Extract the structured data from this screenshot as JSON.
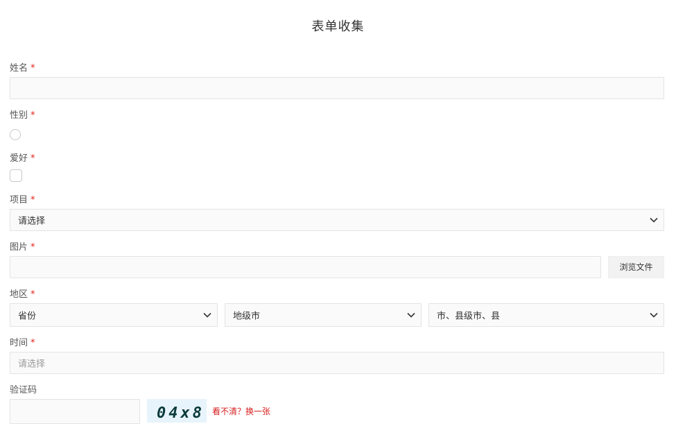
{
  "form": {
    "title": "表单收集",
    "required_mark": "*",
    "fields": {
      "name": {
        "label": "姓名"
      },
      "gender": {
        "label": "性别"
      },
      "hobby": {
        "label": "爱好"
      },
      "project": {
        "label": "项目",
        "selected": "请选择"
      },
      "image": {
        "label": "图片",
        "browse_label": "浏览文件"
      },
      "region": {
        "label": "地区",
        "province": "省份",
        "city": "地级市",
        "county": "市、县级市、县"
      },
      "time": {
        "label": "时间",
        "placeholder": "请选择"
      },
      "captcha": {
        "label": "验证码",
        "code": "04x8",
        "refresh_link": "看不清？换一张"
      }
    }
  },
  "colors": {
    "required": "#e2231a",
    "link": "#d61f1f",
    "input_bg": "#fafafa",
    "input_border": "#e3e3e3"
  },
  "icons": {
    "dropdown": "chevron-down-icon"
  }
}
